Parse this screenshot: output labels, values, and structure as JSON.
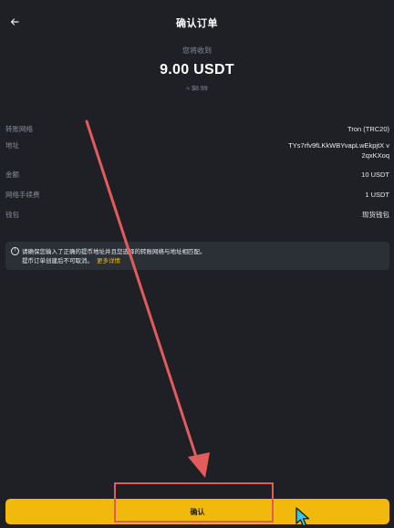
{
  "header": {
    "title": "确认订单",
    "back_icon": "arrow-left-icon"
  },
  "summary": {
    "receive_label": "您将收到",
    "amount": "9.00 USDT",
    "approx": "≈ $8.99"
  },
  "details": [
    {
      "label": "转账网络",
      "value": "Tron (TRC20)"
    },
    {
      "label": "地址",
      "value": "TYs7rfv9fLKkWBYvapLwEkpjtX v2qxKXoq"
    },
    {
      "label": "金额",
      "value": "10 USDT"
    },
    {
      "label": "网络手续费",
      "value": "1 USDT"
    },
    {
      "label": "钱包",
      "value": "现货钱包"
    }
  ],
  "notice": {
    "icon": "info-icon",
    "line1": "请确保您输入了正确的提币地址并且您选择的转账网络与地址相匹配。",
    "line2": "提币订单创建后不可取消。",
    "more_link": "更多详情"
  },
  "confirm_button": {
    "label": "确认"
  },
  "colors": {
    "background": "#1e2026",
    "accent": "#f0b90b",
    "annotation": "#e25c5c",
    "muted_text": "#848e9c"
  }
}
